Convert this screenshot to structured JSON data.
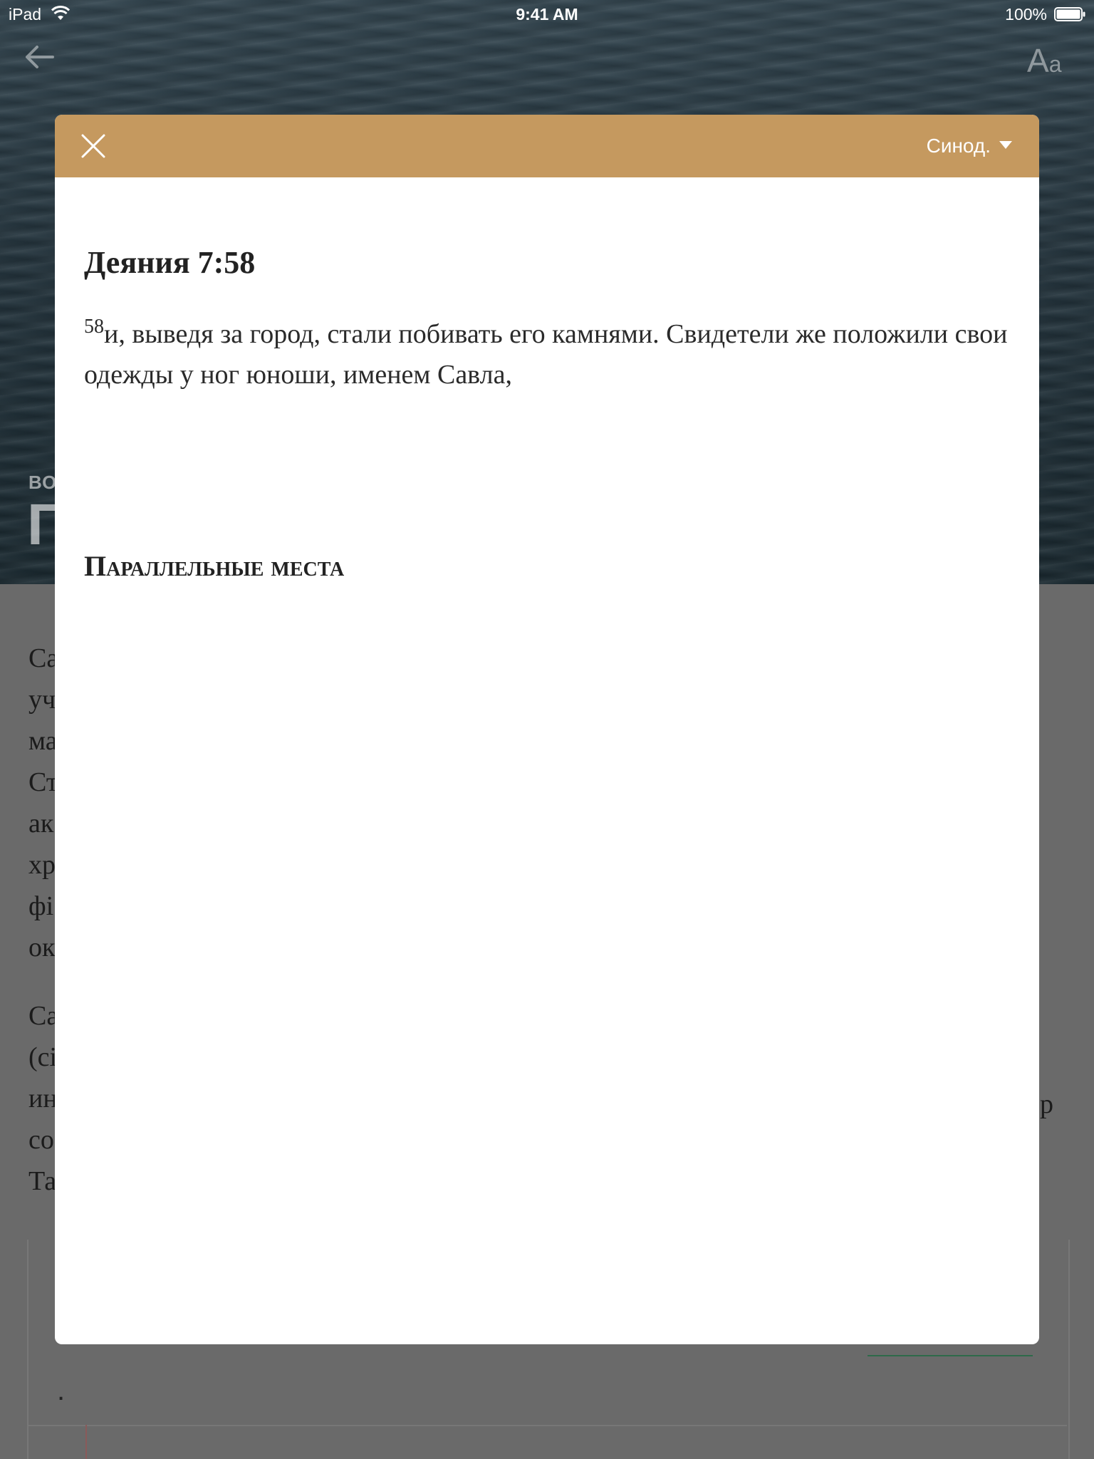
{
  "status_bar": {
    "device": "iPad",
    "time": "9:41 AM",
    "battery": "100%"
  },
  "hero": {
    "kicker": "ВО",
    "title": "Г",
    "font_button": {
      "big": "A",
      "small": "a"
    }
  },
  "article": {
    "lines": [
      "Са",
      "уч",
      "ма",
      "Ст",
      "ак",
      "хр",
      "фі",
      "ок",
      "Са",
      "(сі",
      "ин",
      "со",
      "Та"
    ],
    "right_fragment": "р",
    "dot": "."
  },
  "modal": {
    "translation": "Синод.",
    "verse_reference": "Деяния 7:58",
    "verse_number": "58",
    "verse_text": "и, выведя за город, стали побивать его камнями. Свидетели же положили свои одежды у ног юноши, именем Савла,",
    "parallel_heading": "Параллельные места"
  },
  "colors": {
    "modal_header": "#c5995f",
    "overlay": "#6a6a6a"
  },
  "icons": {
    "back": "arrow-left-icon",
    "close": "close-icon",
    "caret": "caret-down-icon",
    "font": "font-size-icon",
    "wifi": "wifi-icon",
    "battery": "battery-icon"
  }
}
